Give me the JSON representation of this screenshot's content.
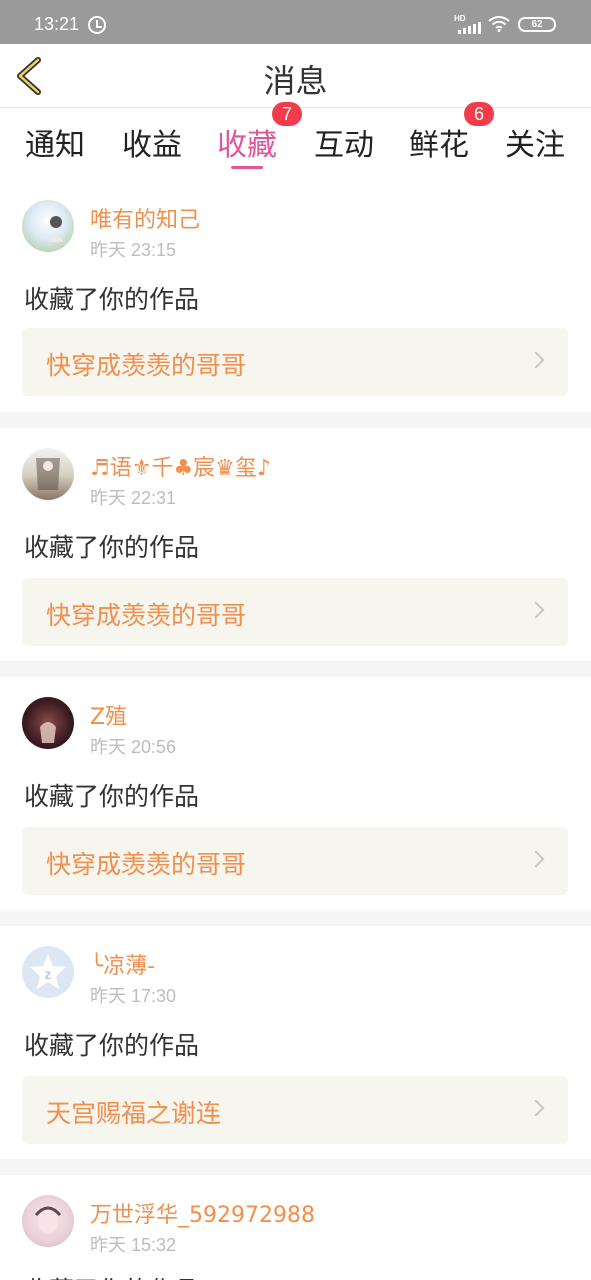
{
  "status": {
    "time": "13:21",
    "network": "HD",
    "battery": "62"
  },
  "header": {
    "title": "消息",
    "back_icon": "chevron-left-icon"
  },
  "tabs": [
    {
      "label": "通知",
      "active": false
    },
    {
      "label": "收益",
      "active": false
    },
    {
      "label": "收藏",
      "active": true,
      "badge": "7"
    },
    {
      "label": "互动",
      "active": false
    },
    {
      "label": "鲜花",
      "active": false,
      "badge": "6"
    },
    {
      "label": "关注",
      "active": false
    }
  ],
  "colors": {
    "accent": "#e1569a",
    "username": "#f08f4e",
    "badge": "#f23c4a",
    "card_bg": "#f6f5ee"
  },
  "messages": [
    {
      "user": "唯有的知己",
      "time": "昨天 23:15",
      "action": "收藏了你的作品",
      "book": "快穿成羡羡的哥哥"
    },
    {
      "user": "♬语⚜千♣宸♛玺♪",
      "time": "昨天 22:31",
      "action": "收藏了你的作品",
      "book": "快穿成羡羡的哥哥"
    },
    {
      "user": "Z殖",
      "time": "昨天 20:56",
      "action": "收藏了你的作品",
      "book": "快穿成羡羡的哥哥"
    },
    {
      "user": "╰凉薄-",
      "time": "昨天 17:30",
      "action": "收藏了你的作品",
      "book": "天宫赐福之谢连"
    },
    {
      "user": "万世浮华_592972988",
      "time": "昨天 15:32",
      "action": "收藏了你的作品",
      "book": ""
    }
  ]
}
